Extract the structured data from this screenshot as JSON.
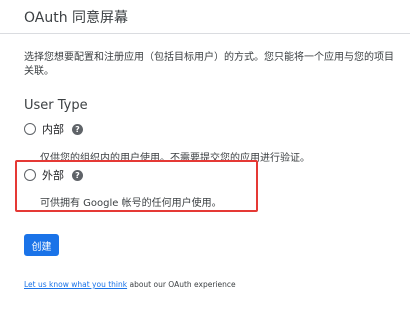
{
  "header": {
    "title": "OAuth 同意屏幕"
  },
  "main": {
    "description": "选择您想要配置和注册应用（包括目标用户）的方式。您只能将一个应用与您的项目关联。",
    "user_type": {
      "title": "User Type",
      "options": [
        {
          "label": "内部",
          "description": "仅供您的组织内的用户使用。不需要提交您的应用进行验证。",
          "selected": false,
          "help_icon": "help-circle-icon",
          "help_glyph": "?"
        },
        {
          "label": "外部",
          "description": "可供拥有 Google 帐号的任何用户使用。",
          "selected": false,
          "highlighted": true,
          "help_icon": "help-circle-icon",
          "help_glyph": "?"
        }
      ]
    },
    "create_label": "创建"
  },
  "feedback": {
    "link_text": "Let us know what you think",
    "suffix": " about our OAuth experience"
  },
  "colors": {
    "primary": "#1a73e8",
    "highlight": "#e53935",
    "text": "#202124",
    "divider": "#dadce0"
  }
}
